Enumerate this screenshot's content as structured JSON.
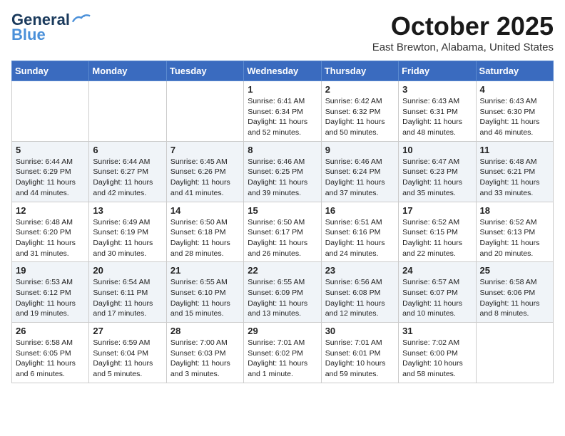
{
  "header": {
    "logo_line1": "General",
    "logo_line2": "Blue",
    "month": "October 2025",
    "location": "East Brewton, Alabama, United States"
  },
  "weekdays": [
    "Sunday",
    "Monday",
    "Tuesday",
    "Wednesday",
    "Thursday",
    "Friday",
    "Saturday"
  ],
  "rows": [
    {
      "cells": [
        {
          "day": "",
          "info": ""
        },
        {
          "day": "",
          "info": ""
        },
        {
          "day": "",
          "info": ""
        },
        {
          "day": "1",
          "info": "Sunrise: 6:41 AM\nSunset: 6:34 PM\nDaylight: 11 hours and 52 minutes."
        },
        {
          "day": "2",
          "info": "Sunrise: 6:42 AM\nSunset: 6:32 PM\nDaylight: 11 hours and 50 minutes."
        },
        {
          "day": "3",
          "info": "Sunrise: 6:43 AM\nSunset: 6:31 PM\nDaylight: 11 hours and 48 minutes."
        },
        {
          "day": "4",
          "info": "Sunrise: 6:43 AM\nSunset: 6:30 PM\nDaylight: 11 hours and 46 minutes."
        }
      ]
    },
    {
      "cells": [
        {
          "day": "5",
          "info": "Sunrise: 6:44 AM\nSunset: 6:29 PM\nDaylight: 11 hours and 44 minutes."
        },
        {
          "day": "6",
          "info": "Sunrise: 6:44 AM\nSunset: 6:27 PM\nDaylight: 11 hours and 42 minutes."
        },
        {
          "day": "7",
          "info": "Sunrise: 6:45 AM\nSunset: 6:26 PM\nDaylight: 11 hours and 41 minutes."
        },
        {
          "day": "8",
          "info": "Sunrise: 6:46 AM\nSunset: 6:25 PM\nDaylight: 11 hours and 39 minutes."
        },
        {
          "day": "9",
          "info": "Sunrise: 6:46 AM\nSunset: 6:24 PM\nDaylight: 11 hours and 37 minutes."
        },
        {
          "day": "10",
          "info": "Sunrise: 6:47 AM\nSunset: 6:23 PM\nDaylight: 11 hours and 35 minutes."
        },
        {
          "day": "11",
          "info": "Sunrise: 6:48 AM\nSunset: 6:21 PM\nDaylight: 11 hours and 33 minutes."
        }
      ]
    },
    {
      "cells": [
        {
          "day": "12",
          "info": "Sunrise: 6:48 AM\nSunset: 6:20 PM\nDaylight: 11 hours and 31 minutes."
        },
        {
          "day": "13",
          "info": "Sunrise: 6:49 AM\nSunset: 6:19 PM\nDaylight: 11 hours and 30 minutes."
        },
        {
          "day": "14",
          "info": "Sunrise: 6:50 AM\nSunset: 6:18 PM\nDaylight: 11 hours and 28 minutes."
        },
        {
          "day": "15",
          "info": "Sunrise: 6:50 AM\nSunset: 6:17 PM\nDaylight: 11 hours and 26 minutes."
        },
        {
          "day": "16",
          "info": "Sunrise: 6:51 AM\nSunset: 6:16 PM\nDaylight: 11 hours and 24 minutes."
        },
        {
          "day": "17",
          "info": "Sunrise: 6:52 AM\nSunset: 6:15 PM\nDaylight: 11 hours and 22 minutes."
        },
        {
          "day": "18",
          "info": "Sunrise: 6:52 AM\nSunset: 6:13 PM\nDaylight: 11 hours and 20 minutes."
        }
      ]
    },
    {
      "cells": [
        {
          "day": "19",
          "info": "Sunrise: 6:53 AM\nSunset: 6:12 PM\nDaylight: 11 hours and 19 minutes."
        },
        {
          "day": "20",
          "info": "Sunrise: 6:54 AM\nSunset: 6:11 PM\nDaylight: 11 hours and 17 minutes."
        },
        {
          "day": "21",
          "info": "Sunrise: 6:55 AM\nSunset: 6:10 PM\nDaylight: 11 hours and 15 minutes."
        },
        {
          "day": "22",
          "info": "Sunrise: 6:55 AM\nSunset: 6:09 PM\nDaylight: 11 hours and 13 minutes."
        },
        {
          "day": "23",
          "info": "Sunrise: 6:56 AM\nSunset: 6:08 PM\nDaylight: 11 hours and 12 minutes."
        },
        {
          "day": "24",
          "info": "Sunrise: 6:57 AM\nSunset: 6:07 PM\nDaylight: 11 hours and 10 minutes."
        },
        {
          "day": "25",
          "info": "Sunrise: 6:58 AM\nSunset: 6:06 PM\nDaylight: 11 hours and 8 minutes."
        }
      ]
    },
    {
      "cells": [
        {
          "day": "26",
          "info": "Sunrise: 6:58 AM\nSunset: 6:05 PM\nDaylight: 11 hours and 6 minutes."
        },
        {
          "day": "27",
          "info": "Sunrise: 6:59 AM\nSunset: 6:04 PM\nDaylight: 11 hours and 5 minutes."
        },
        {
          "day": "28",
          "info": "Sunrise: 7:00 AM\nSunset: 6:03 PM\nDaylight: 11 hours and 3 minutes."
        },
        {
          "day": "29",
          "info": "Sunrise: 7:01 AM\nSunset: 6:02 PM\nDaylight: 11 hours and 1 minute."
        },
        {
          "day": "30",
          "info": "Sunrise: 7:01 AM\nSunset: 6:01 PM\nDaylight: 10 hours and 59 minutes."
        },
        {
          "day": "31",
          "info": "Sunrise: 7:02 AM\nSunset: 6:00 PM\nDaylight: 10 hours and 58 minutes."
        },
        {
          "day": "",
          "info": ""
        }
      ]
    }
  ]
}
